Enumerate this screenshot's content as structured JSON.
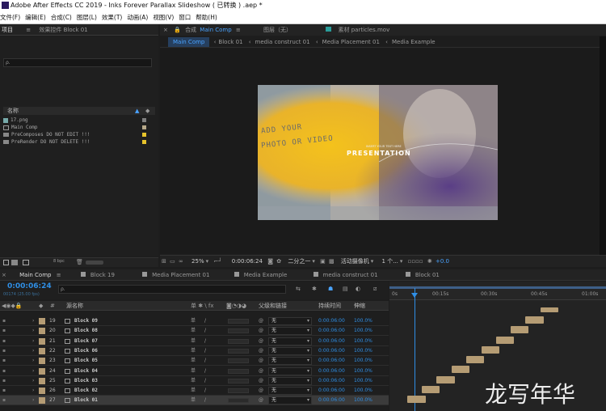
{
  "app": {
    "title": "Adobe After Effects CC 2019 - Inks Forever Parallax Slideshow ( 已转换 ) .aep *"
  },
  "menu": [
    "文件(F)",
    "编辑(E)",
    "合成(C)",
    "图层(L)",
    "效果(T)",
    "动画(A)",
    "视图(V)",
    "窗口",
    "帮助(H)"
  ],
  "project_panel": {
    "tab_project": "项目",
    "tab_effects": "效果控件 Block 01",
    "search_icon_text": "ρ.",
    "col_name": "名称",
    "items": [
      {
        "name": "17.png",
        "icon": "image-icon",
        "swatch": "#7f7f7f"
      },
      {
        "name": "Main Comp",
        "icon": "comp-icon",
        "swatch": "#b7a98a"
      },
      {
        "name": "PreComposes DO NOT EDIT !!!",
        "icon": "folder-icon",
        "swatch": "#e6c32b"
      },
      {
        "name": "PreRender DO NOT DELETE !!!",
        "icon": "folder-icon",
        "swatch": "#e6c32b"
      }
    ],
    "bpc": "8 bpc"
  },
  "comp_panel": {
    "tab_prefix": "合成",
    "tab_name": "Main Comp",
    "layer_tab": "图层（无）",
    "footage_tab": "素材 particles.mov",
    "breadcrumbs": [
      "Main Comp",
      "Block 01",
      "media construct 01",
      "Media Placement 01",
      "Media Example"
    ],
    "preview": {
      "line1": "ADD YOUR",
      "line2": "PHOTO OR VIDEO",
      "small": "INSERT YOUR TEXT HERE",
      "big": "PRESENTATION"
    },
    "controls": {
      "zoom": "25%",
      "timecode": "0:00:06:24",
      "resolution": "二分之一",
      "camera": "活动摄像机",
      "views": "1 个...",
      "exposure": "+0.0"
    }
  },
  "timeline": {
    "tabs": [
      "Main Comp",
      "Block 19",
      "Media Placement 01",
      "Media Example",
      "media construct 01",
      "Block 01"
    ],
    "timecode": "0:00:06:24",
    "sub_timecode": "00174 (25.00 fps)",
    "search_icon_text": "ρ.",
    "headers": {
      "num": "#",
      "source": "源名称",
      "switches": "单 ✱ \\ fx",
      "parent": "父级和链接",
      "duration": "持续时间",
      "stretch": "伸缩"
    },
    "ruler": [
      "0s",
      "00:15s",
      "00:30s",
      "00:45s",
      "01:00s"
    ],
    "layers": [
      {
        "num": "19",
        "name": "Block 09",
        "parent": "无",
        "duration": "0:00:06:00",
        "stretch": "100.0%"
      },
      {
        "num": "20",
        "name": "Block 08",
        "parent": "无",
        "duration": "0:00:06:00",
        "stretch": "100.0%"
      },
      {
        "num": "21",
        "name": "Block 07",
        "parent": "无",
        "duration": "0:00:06:00",
        "stretch": "100.0%"
      },
      {
        "num": "22",
        "name": "Block 06",
        "parent": "无",
        "duration": "0:00:06:00",
        "stretch": "100.0%"
      },
      {
        "num": "23",
        "name": "Block 05",
        "parent": "无",
        "duration": "0:00:06:00",
        "stretch": "100.0%"
      },
      {
        "num": "24",
        "name": "Block 04",
        "parent": "无",
        "duration": "0:00:06:00",
        "stretch": "100.0%"
      },
      {
        "num": "25",
        "name": "Block 03",
        "parent": "无",
        "duration": "0:00:06:00",
        "stretch": "100.0%"
      },
      {
        "num": "26",
        "name": "Block 02",
        "parent": "无",
        "duration": "0:00:06:00",
        "stretch": "100.0%"
      },
      {
        "num": "27",
        "name": "Block 01",
        "parent": "无",
        "duration": "0:00:06:00",
        "stretch": "100.0%"
      }
    ]
  },
  "watermark": "龙写年华",
  "colors": {
    "accent": "#2f8fe6",
    "label_tan": "#b59c74",
    "highlight_tab": "#4aa3ff"
  }
}
